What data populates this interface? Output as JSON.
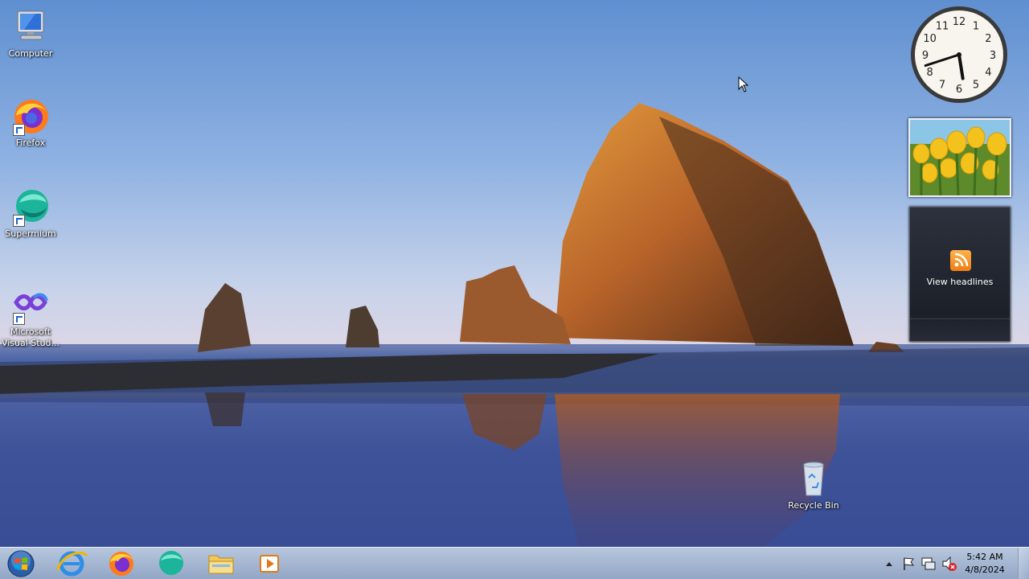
{
  "desktop": {
    "icons": [
      {
        "label": "Computer",
        "icon": "computer-icon"
      },
      {
        "label": "Firefox",
        "icon": "firefox-icon"
      },
      {
        "label": "Supermium",
        "icon": "supermium-icon"
      },
      {
        "label": "Microsoft Visual Stud...",
        "icon": "visual-studio-icon"
      },
      {
        "label": "Recycle Bin",
        "icon": "recycle-bin-icon"
      }
    ]
  },
  "gadgets": {
    "clock": {
      "numerals": [
        "12",
        "1",
        "2",
        "3",
        "4",
        "5",
        "6",
        "7",
        "8",
        "9",
        "10",
        "11"
      ],
      "time_shown": "5:42"
    },
    "feed": {
      "label": "View headlines",
      "icon": "rss-icon"
    },
    "slideshow": {
      "icon": "tulips-photo"
    }
  },
  "taskbar": {
    "start": {
      "icon": "windows-orb-icon"
    },
    "pinned": [
      {
        "icon": "internet-explorer-icon"
      },
      {
        "icon": "firefox-icon"
      },
      {
        "icon": "supermium-icon"
      },
      {
        "icon": "file-explorer-icon"
      },
      {
        "icon": "media-player-icon"
      }
    ],
    "tray": {
      "icons": [
        "show-hidden-icons-icon",
        "action-center-flag-icon",
        "network-icon",
        "volume-muted-icon"
      ],
      "time": "5:42 AM",
      "date": "4/8/2024"
    }
  },
  "colors": {
    "accent": "#1d63c9",
    "feed_bg": "#1c2029",
    "rss": "#f07d12"
  }
}
